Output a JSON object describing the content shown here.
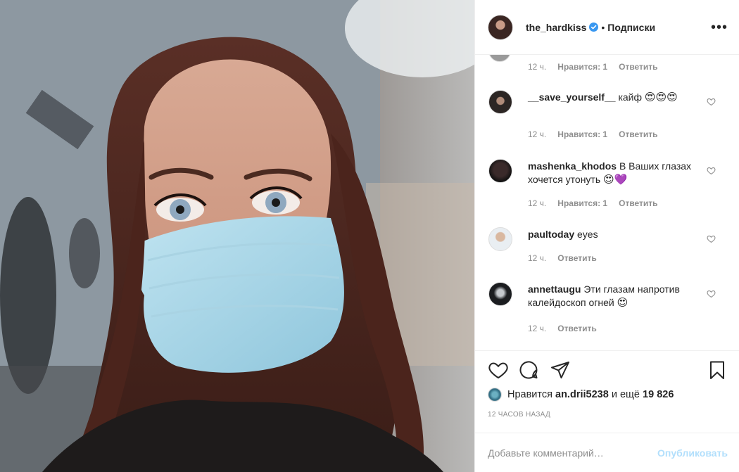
{
  "post": {
    "username": "the_hardkiss",
    "follow_label": "Подписки",
    "separator": "•",
    "more_label": "•••"
  },
  "comments": {
    "top_meta": {
      "time": "12 ч.",
      "likes": "Нравится: 1",
      "reply": "Ответить"
    },
    "items": [
      {
        "username": "__save_yourself__",
        "text": "кайф",
        "emoji": "😍😍😍",
        "time": "12 ч.",
        "likes": "Нравится: 1",
        "reply": "Ответить"
      },
      {
        "username": "mashenka_khodos",
        "text": "В Ваших глазах хочется утонуть",
        "emoji": "😍💜",
        "time": "12 ч.",
        "likes": "Нравится: 1",
        "reply": "Ответить"
      },
      {
        "username": "paultoday",
        "text": "eyes",
        "emoji": "",
        "time": "12 ч.",
        "likes": "",
        "reply": "Ответить"
      },
      {
        "username": "annettaugu",
        "text": "Эти глазам напротив калейдоскоп огней",
        "emoji": "😍",
        "time": "12 ч.",
        "likes": "",
        "reply": "Ответить"
      }
    ]
  },
  "likes": {
    "prefix": "Нравится",
    "liker": "an.drii5238",
    "joiner": "и ещё",
    "count": "19 826"
  },
  "timestamp": "12 ЧАСОВ НАЗАД",
  "add_comment": {
    "placeholder": "Добавьте комментарий…",
    "publish_label": "Опубликовать"
  },
  "icons": {
    "like": "heart-icon",
    "comment": "comment-icon",
    "share": "paper-plane-icon",
    "save": "bookmark-icon",
    "verified": "verified-badge-icon",
    "comment_like": "heart-outline-icon"
  },
  "colors": {
    "verified": "#3897f0",
    "publish_disabled": "#b2dffc",
    "secondary_text": "#8e8e8e",
    "primary_text": "#262626"
  }
}
